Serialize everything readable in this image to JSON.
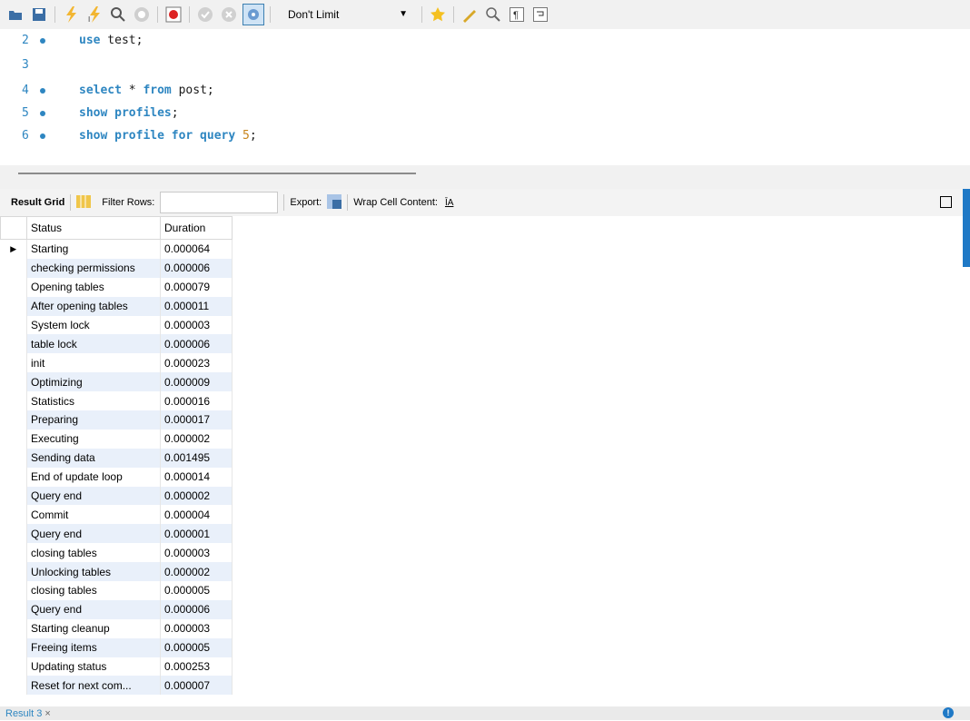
{
  "toolbar": {
    "limit_select": "Don't Limit",
    "icons": [
      "folder-open-icon",
      "save-icon",
      "execute-icon",
      "execute-current-icon",
      "explain-icon",
      "stop-icon",
      "toggle-error-icon",
      "commit-icon",
      "rollback-icon",
      "autocommit-icon",
      "bookmark-icon",
      "beautify-icon",
      "find-icon",
      "invisible-chars-icon",
      "wrap-icon"
    ]
  },
  "editor": {
    "lines": [
      {
        "no": "2",
        "dot": true,
        "code": "use test;"
      },
      {
        "no": "3",
        "dot": false,
        "code": ""
      },
      {
        "no": "4",
        "dot": true,
        "code": "select * from post;"
      },
      {
        "no": "5",
        "dot": true,
        "code": "show profiles;"
      },
      {
        "no": "6",
        "dot": true,
        "code": "show profile for query 5;"
      }
    ]
  },
  "result_toolbar": {
    "result_grid": "Result Grid",
    "filter_rows": "Filter Rows:",
    "export": "Export:",
    "wrap_cell": "Wrap Cell Content:"
  },
  "grid": {
    "columns": [
      "Status",
      "Duration"
    ],
    "rows": [
      [
        "Starting",
        "0.000064"
      ],
      [
        "checking permissions",
        "0.000006"
      ],
      [
        "Opening tables",
        "0.000079"
      ],
      [
        "After opening tables",
        "0.000011"
      ],
      [
        "System lock",
        "0.000003"
      ],
      [
        "table lock",
        "0.000006"
      ],
      [
        "init",
        "0.000023"
      ],
      [
        "Optimizing",
        "0.000009"
      ],
      [
        "Statistics",
        "0.000016"
      ],
      [
        "Preparing",
        "0.000017"
      ],
      [
        "Executing",
        "0.000002"
      ],
      [
        "Sending data",
        "0.001495"
      ],
      [
        "End of update loop",
        "0.000014"
      ],
      [
        "Query end",
        "0.000002"
      ],
      [
        "Commit",
        "0.000004"
      ],
      [
        "Query end",
        "0.000001"
      ],
      [
        "closing tables",
        "0.000003"
      ],
      [
        "Unlocking tables",
        "0.000002"
      ],
      [
        "closing tables",
        "0.000005"
      ],
      [
        "Query end",
        "0.000006"
      ],
      [
        "Starting cleanup",
        "0.000003"
      ],
      [
        "Freeing items",
        "0.000005"
      ],
      [
        "Updating status",
        "0.000253"
      ],
      [
        "Reset for next com...",
        "0.000007"
      ]
    ]
  },
  "bottom": {
    "result_tab": "Result 3"
  },
  "colors": {
    "accent": "#2e86c1",
    "alt_row": "#e9f0fa"
  }
}
